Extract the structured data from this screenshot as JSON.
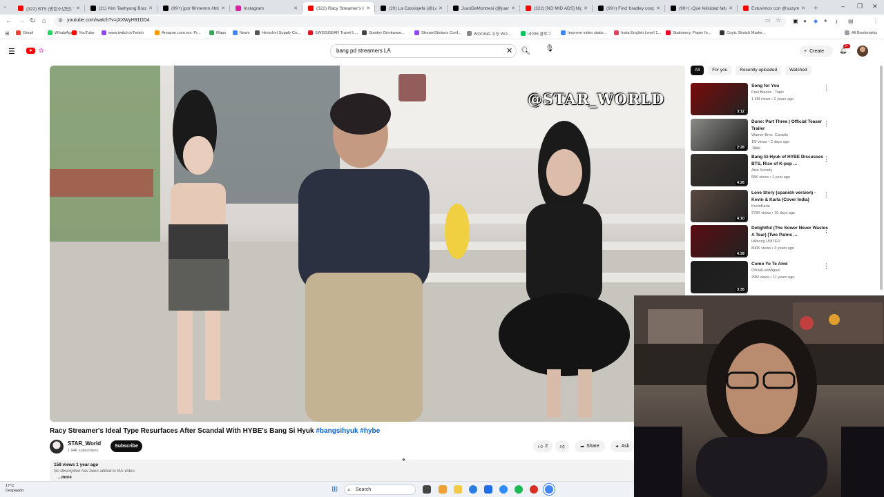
{
  "browser": {
    "tabs": [
      {
        "title": "(322) BTS (방탄소년단) 'S",
        "color": "#ff0000"
      },
      {
        "title": "(21) Kim Taehyung Brazil",
        "color": "#000000"
      },
      {
        "title": "(99+) jpor flinnennn #btsci",
        "color": "#000000"
      },
      {
        "title": "Instagram",
        "color": "#d6249f"
      },
      {
        "title": "(322) Racy Streamer's Ide",
        "color": "#ff0000",
        "active": true
      },
      {
        "title": "(20) La Cassiojefa (@LaCu",
        "color": "#000000"
      },
      {
        "title": "JuanDeMontresi (@juanc",
        "color": "#000000"
      },
      {
        "title": "(322) [NO MID ADS] Night",
        "color": "#ff0000"
      },
      {
        "title": "(99+) Find 'bradley cooper",
        "color": "#000000"
      },
      {
        "title": "(99+) ¡Qué felicidad falta p",
        "color": "#000000"
      },
      {
        "title": "Estuvimos con @suzymo",
        "color": "#ff0000"
      }
    ],
    "url": "youtube.com/watch?v=jXXWyH91DD4",
    "bookmarks": [
      {
        "label": "Gmail",
        "color": "#ea4335"
      },
      {
        "label": "WhatsApp",
        "color": "#25d366"
      },
      {
        "label": "YouTube",
        "color": "#ff0000"
      },
      {
        "label": "www.twitch.tvTwitch",
        "color": "#9146ff"
      },
      {
        "label": "Amazon.com.mx: Pr...",
        "color": "#ff9900"
      },
      {
        "label": "Maps",
        "color": "#34a853"
      },
      {
        "label": "News",
        "color": "#4285f4"
      },
      {
        "label": "Herschel Supply Co...",
        "color": "#555555"
      },
      {
        "label": "SWISSGEAR Travel L...",
        "color": "#d71920"
      },
      {
        "label": "Stanley Drinkware...",
        "color": "#444444"
      },
      {
        "label": "StreamStickers Conf...",
        "color": "#9146ff"
      },
      {
        "label": "WOOING 우잉 WO...",
        "color": "#888888"
      },
      {
        "label": "네이버 클루그",
        "color": "#03c75a"
      },
      {
        "label": "Improve video statis...",
        "color": "#4285f4"
      },
      {
        "label": "Insta English Level 1...",
        "color": "#e4405f"
      },
      {
        "label": "Stationery, Paper fo...",
        "color": "#e60023"
      },
      {
        "label": "Copic Sketch Marke...",
        "color": "#333333"
      }
    ],
    "all_bookmarks": "All Bookmarks"
  },
  "youtube": {
    "search_query": "bang pd streamers LA",
    "create_label": "Create",
    "notif_badge": "9+",
    "video_watermark": "@STAR_WORLD",
    "video_title": "Racy Streamer's Ideal Type Resurfaces After Scandal With HYBE's Bang Si Hyuk",
    "hashtag1": "#bangsihyuk",
    "hashtag2": "#hybe",
    "channel_name": "STAR_World",
    "channel_subs": "1.94K subscribers",
    "subscribe_label": "Subscribe",
    "like_count": "2",
    "share_label": "Share",
    "ask_label": "Ask",
    "views_line": "158 views  1 year ago",
    "description": "No description has been added to this video.",
    "more_label": "...more",
    "chips": [
      "All",
      "For you",
      "Recently uploaded",
      "Watched"
    ],
    "recommendations": [
      {
        "title": "Song for You",
        "channel": "Paul Blanco - Topic",
        "meta": "1.6M views • 2 years ago",
        "duration": "3:12",
        "thumb": "#7a0a0a"
      },
      {
        "title": "Dune: Part Three | Official Teaser Trailer",
        "channel": "Warner Bros. Canada",
        "meta": "1M views • 2 days ago",
        "badge": "New",
        "duration": "2:28",
        "thumb": "#8a8a86"
      },
      {
        "title": "Bang Si-Hyuk of HYBE Discusses BTS, Rise of K-pop ...",
        "channel": "Asia Society",
        "meta": "58K views • 1 year ago",
        "duration": "4:26",
        "thumb": "#3a3530"
      },
      {
        "title": "Love Story (spanish version) - Kevin & Karla (Cover India)",
        "channel": "KevinKarla",
        "meta": "279K views • 10 days ago",
        "duration": "4:10",
        "thumb": "#5a4a42"
      },
      {
        "title": "Delightful (The Sower Never Wastes A Tear) [Two Palms ...",
        "channel": "Hillsong UNITED",
        "meta": "800K views • 3 years ago",
        "duration": "4:39",
        "thumb": "#5a0c12"
      },
      {
        "title": "Como Yo Te Amé",
        "channel": "OficialLuisMiguel",
        "meta": "29M views • 11 years ago",
        "duration": "3:35",
        "thumb": "#1c1c1c"
      }
    ]
  },
  "taskbar": {
    "temp": "17°C",
    "weather": "Despejado",
    "search_label": "Search"
  }
}
